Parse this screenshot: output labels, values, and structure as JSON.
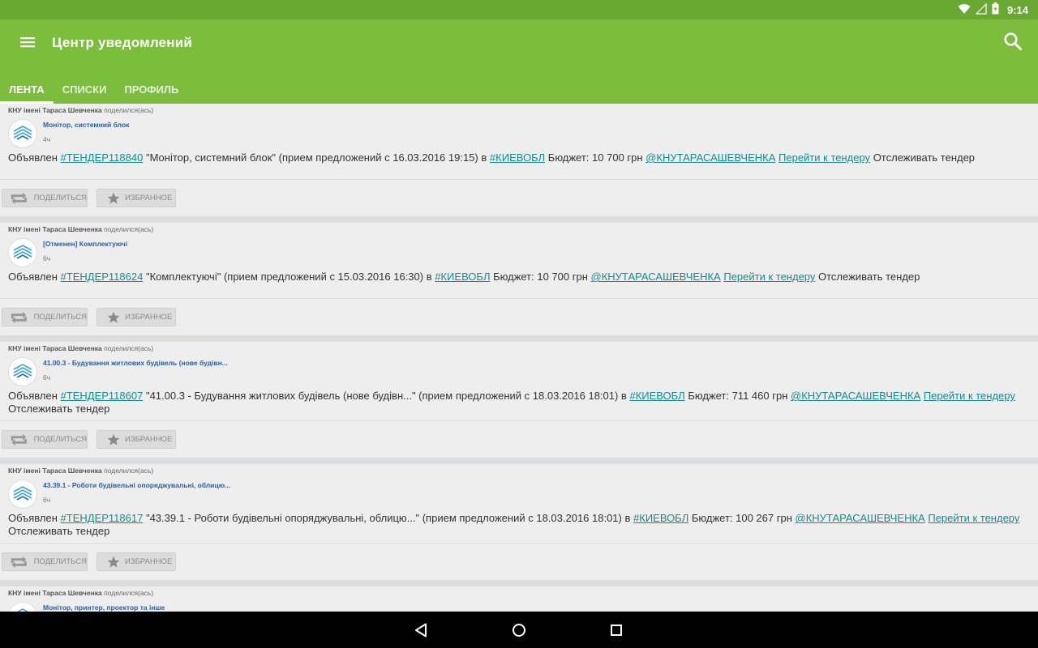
{
  "status_bar": {
    "time": "9:14"
  },
  "app_bar": {
    "title": "Центр уведомлений"
  },
  "tabs": [
    {
      "label": "ЛЕНТА",
      "active": true
    },
    {
      "label": "СПИСКИ",
      "active": false
    },
    {
      "label": "ПРОФИЛЬ",
      "active": false
    }
  ],
  "actions": {
    "share_label": "ПОДЕЛИТЬСЯ",
    "favorite_label": "ИЗБРАННОЕ"
  },
  "posts": [
    {
      "author": "КНУ імені Тараса Шевченка",
      "shared": "поделился(ась)",
      "title": "Монітор, системний блок",
      "time": "4ч",
      "prefix": "Объявлен",
      "tender": "#ТЕНДЕР118840",
      "text": "\"Монітор, системний блок\" (прием предложений с 16.03.2016 19:15) в",
      "region": "#КИЕВОБЛ",
      "budget": "Бюджет: 10 700 грн",
      "org": "@КНУТАРАСАШЕВЧЕНКА",
      "link": "Перейти к тендеру",
      "track": "Отслеживать тендер"
    },
    {
      "author": "КНУ імені Тараса Шевченка",
      "shared": "поделился(ась)",
      "title": "[Отменен] Комплектуючі",
      "time": "6ч",
      "prefix": "Объявлен",
      "tender": "#ТЕНДЕР118624",
      "text": "\"Комплектуючі\" (прием предложений с 15.03.2016 16:30) в",
      "region": "#КИЕВОБЛ",
      "budget": "Бюджет: 10 700 грн",
      "org": "@КНУТАРАСАШЕВЧЕНКА",
      "link": "Перейти к тендеру",
      "track": "Отслеживать тендер"
    },
    {
      "author": "КНУ імені Тараса Шевченка",
      "shared": "поделился(ась)",
      "title": "41.00.3 - Будування житлових будівель (нове будівн...",
      "time": "6ч",
      "prefix": "Объявлен",
      "tender": "#ТЕНДЕР118607",
      "text": "\"41.00.3 - Будування житлових будівель (нове будівн...\" (прием предложений с 18.03.2016 18:01) в",
      "region": "#КИЕВОБЛ",
      "budget": "Бюджет: 711 460 грн",
      "org": "@КНУТАРАСАШЕВЧЕНКА",
      "link": "Перейти к тендеру",
      "track": "Отслеживать тендер"
    },
    {
      "author": "КНУ імені Тараса Шевченка",
      "shared": "поделился(ась)",
      "title": "43.39.1 - Роботи будівельні опоряджувальні, облицю...",
      "time": "6ч",
      "prefix": "Объявлен",
      "tender": "#ТЕНДЕР118617",
      "text": "\"43.39.1 - Роботи будівельні опоряджувальні, облицю...\" (прием предложений с 18.03.2016 18:01) в",
      "region": "#КИЕВОБЛ",
      "budget": "Бюджет: 100 267 грн",
      "org": "@КНУТАРАСАШЕВЧЕНКА",
      "link": "Перейти к тендеру",
      "track": "Отслеживать тендер"
    },
    {
      "author": "КНУ імені Тараса Шевченка",
      "shared": "поделился(ась)",
      "title": "Монітор, принтер, проектор та інше",
      "time": "",
      "prefix": "",
      "tender": "",
      "text": "",
      "region": "",
      "budget": "",
      "org": "",
      "link": "",
      "track": ""
    }
  ]
}
